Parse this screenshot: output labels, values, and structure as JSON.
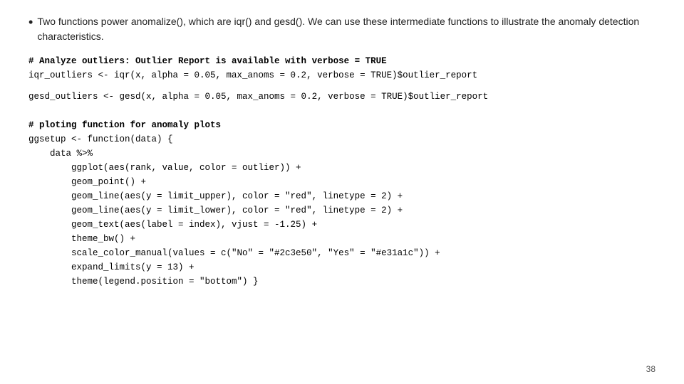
{
  "page": {
    "page_number": "38"
  },
  "bullet": {
    "dot": "•",
    "text": "Two functions power anomalize(), which are iqr() and gesd(). We can use these intermediate functions to illustrate the anomaly detection characteristics."
  },
  "code_blocks": [
    {
      "id": "comment1",
      "type": "comment",
      "text": "# Analyze outliers: Outlier Report is available with verbose = TRUE"
    },
    {
      "id": "line1",
      "type": "code",
      "text": "iqr_outliers <- iqr(x, alpha = 0.05, max_anoms = 0.2, verbose = TRUE)$outlier_report"
    },
    {
      "id": "blank1",
      "type": "blank"
    },
    {
      "id": "line2",
      "type": "code",
      "text": "gesd_outliers <- gesd(x, alpha = 0.05, max_anoms = 0.2, verbose = TRUE)$outlier_report"
    },
    {
      "id": "blank2",
      "type": "blank"
    },
    {
      "id": "blank3",
      "type": "blank"
    },
    {
      "id": "comment2",
      "type": "comment",
      "text": "# ploting function for anomaly plots"
    },
    {
      "id": "line3",
      "type": "code",
      "text": "ggsetup <- function(data) {"
    },
    {
      "id": "line4",
      "type": "code",
      "text": "    data %>%"
    },
    {
      "id": "line5",
      "type": "code",
      "text": "        ggplot(aes(rank, value, color = outlier)) +"
    },
    {
      "id": "line6",
      "type": "code",
      "text": "        geom_point() +"
    },
    {
      "id": "line7",
      "type": "code",
      "text": "        geom_line(aes(y = limit_upper), color = \"red\", linetype = 2) +"
    },
    {
      "id": "line8",
      "type": "code",
      "text": "        geom_line(aes(y = limit_lower), color = \"red\", linetype = 2) +"
    },
    {
      "id": "line9",
      "type": "code",
      "text": "        geom_text(aes(label = index), vjust = -1.25) +"
    },
    {
      "id": "line10",
      "type": "code",
      "text": "        theme_bw() +"
    },
    {
      "id": "line11",
      "type": "code",
      "text": "        scale_color_manual(values = c(\"No\" = \"#2c3e50\", \"Yes\" = \"#e31a1c\")) +"
    },
    {
      "id": "line12",
      "type": "code",
      "text": "        expand_limits(y = 13) +"
    },
    {
      "id": "line13",
      "type": "code",
      "text": "        theme(legend.position = \"bottom\") }"
    }
  ]
}
